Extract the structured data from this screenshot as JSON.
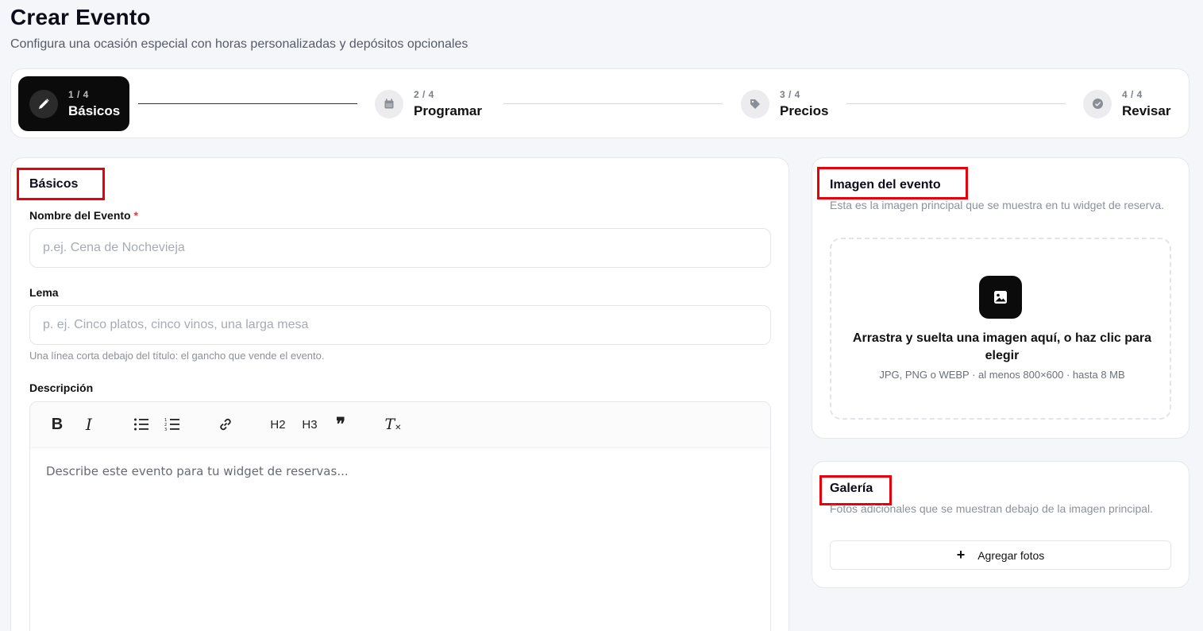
{
  "header": {
    "title": "Crear Evento",
    "subtitle": "Configura una ocasión especial con horas personalizadas y depósitos opcionales"
  },
  "stepper": {
    "steps": [
      {
        "count": "1 / 4",
        "label": "Básicos",
        "icon": "pencil-icon",
        "active": true
      },
      {
        "count": "2 / 4",
        "label": "Programar",
        "icon": "calendar-icon",
        "active": false
      },
      {
        "count": "3 / 4",
        "label": "Precios",
        "icon": "tag-icon",
        "active": false
      },
      {
        "count": "4 / 4",
        "label": "Revisar",
        "icon": "check-circle-icon",
        "active": false
      }
    ]
  },
  "basics": {
    "title": "Básicos",
    "name_label": "Nombre del Evento",
    "required_mark": "*",
    "name_placeholder": "p.ej. Cena de Nochevieja",
    "tagline_label": "Lema",
    "tagline_placeholder": "p. ej. Cinco platos, cinco vinos, una larga mesa",
    "tagline_hint": "Una línea corta debajo del título: el gancho que vende el evento.",
    "description_label": "Descripción",
    "description_placeholder": "Describe este evento para tu widget de reservas...",
    "toolbar": {
      "bold": "B",
      "italic": "I",
      "h2": "H2",
      "h3": "H3",
      "quote": "❞",
      "clear": "T"
    }
  },
  "image": {
    "title": "Imagen del evento",
    "description": "Esta es la imagen principal que se muestra en tu widget de reserva.",
    "drop_title": "Arrastra y suelta una imagen aquí, o haz clic para elegir",
    "drop_hint": "JPG, PNG o WEBP · al menos 800×600 · hasta 8 MB"
  },
  "gallery": {
    "title": "Galería",
    "description": "Fotos adicionales que se muestran debajo de la imagen principal.",
    "add_label": "Agregar fotos",
    "add_icon": "+"
  },
  "colors": {
    "accent": "#0b0b0b",
    "highlight": "#e8000b",
    "required": "#e23b3b"
  }
}
